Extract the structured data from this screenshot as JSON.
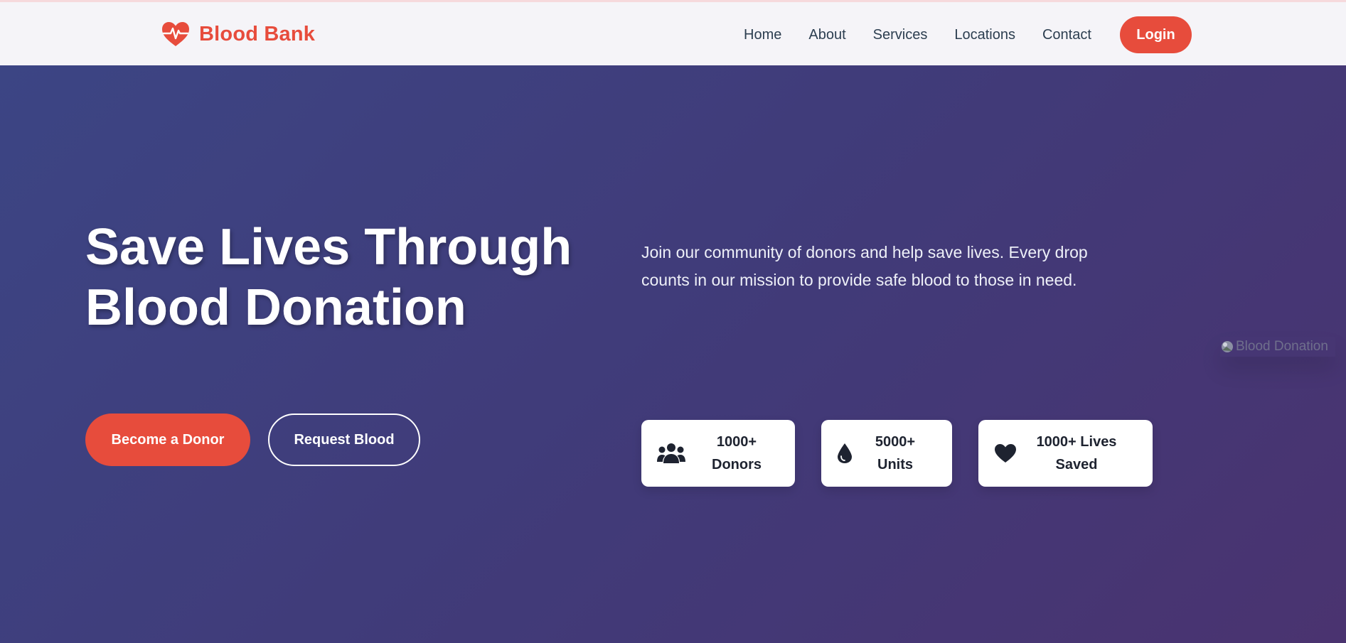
{
  "navbar": {
    "brand": "Blood Bank",
    "brand_icon": "heartbeat-icon",
    "brand_color": "#e74c3c",
    "links": [
      "Home",
      "About",
      "Services",
      "Locations",
      "Contact"
    ],
    "login_label": "Login"
  },
  "hero": {
    "title": "Save Lives Through Blood Donation",
    "description": "Join our community of donors and help save lives. Every drop counts in our mission to provide safe blood to those in need.",
    "image_alt": "Blood Donation",
    "primary_button": "Become a Donor",
    "secondary_button": "Request Blood",
    "accent_color": "#e74c3c"
  },
  "stats": [
    {
      "icon": "users-icon",
      "label": "1000+ Donors"
    },
    {
      "icon": "blood-drop-icon",
      "label": "5000+ Units"
    },
    {
      "icon": "heart-icon",
      "label": "1000+ Lives Saved"
    }
  ]
}
